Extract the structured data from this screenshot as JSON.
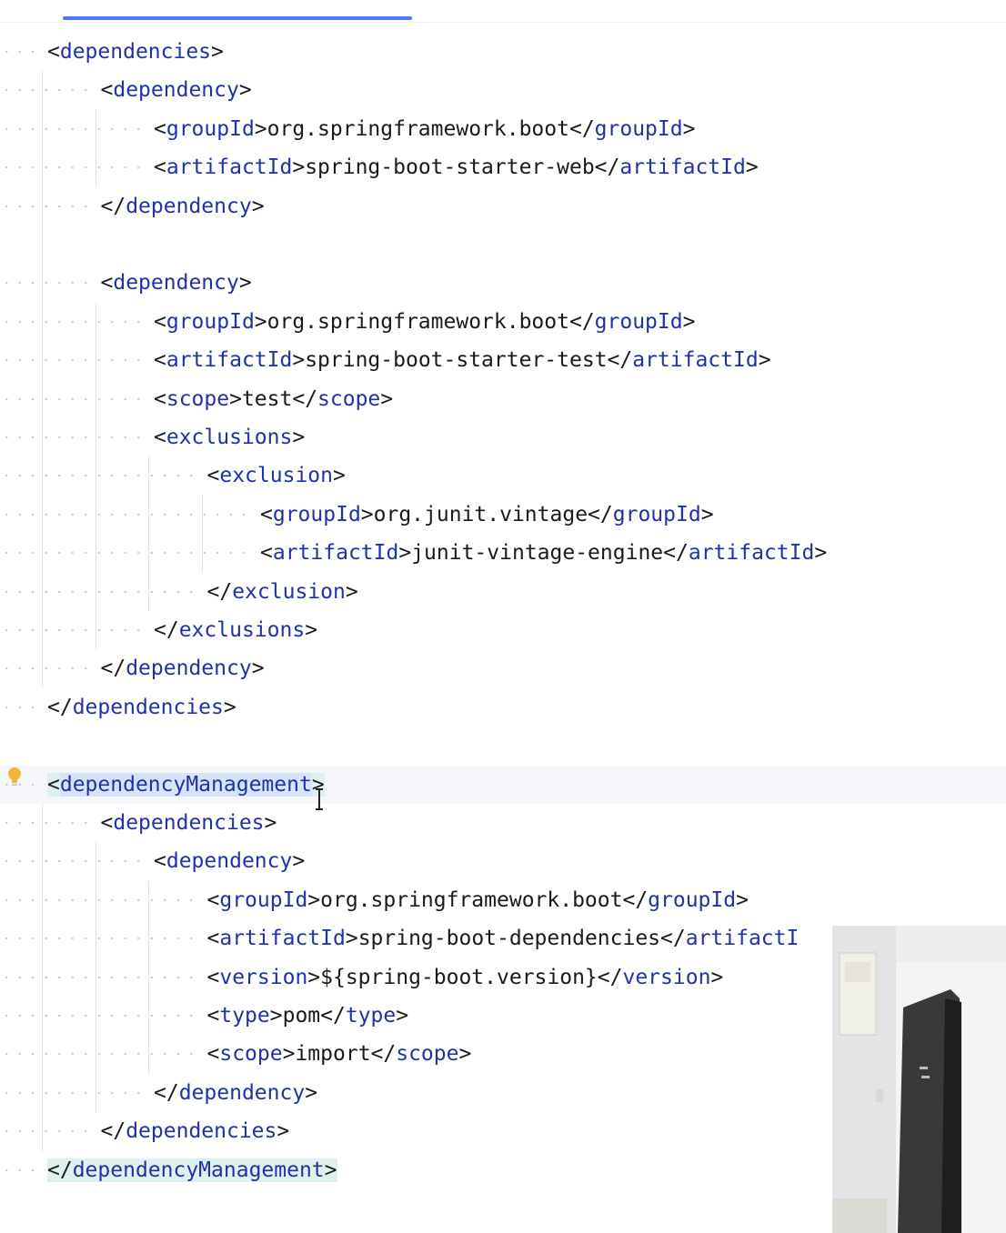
{
  "editor": {
    "lines": [
      {
        "indent": 0,
        "tokens": [
          {
            "t": "<",
            "k": "p"
          },
          {
            "t": "dependencies",
            "k": "tag"
          },
          {
            "t": ">",
            "k": "p"
          }
        ]
      },
      {
        "indent": 1,
        "tokens": [
          {
            "t": "<",
            "k": "p"
          },
          {
            "t": "dependency",
            "k": "tag"
          },
          {
            "t": ">",
            "k": "p"
          }
        ]
      },
      {
        "indent": 2,
        "tokens": [
          {
            "t": "<",
            "k": "p"
          },
          {
            "t": "groupId",
            "k": "tag"
          },
          {
            "t": ">org.springframework.boot</",
            "k": "p"
          },
          {
            "t": "groupId",
            "k": "tag"
          },
          {
            "t": ">",
            "k": "p"
          }
        ]
      },
      {
        "indent": 2,
        "tokens": [
          {
            "t": "<",
            "k": "p"
          },
          {
            "t": "artifactId",
            "k": "tag"
          },
          {
            "t": ">spring-boot-starter-web</",
            "k": "p"
          },
          {
            "t": "artifactId",
            "k": "tag"
          },
          {
            "t": ">",
            "k": "p"
          }
        ]
      },
      {
        "indent": 1,
        "tokens": [
          {
            "t": "</",
            "k": "p"
          },
          {
            "t": "dependency",
            "k": "tag"
          },
          {
            "t": ">",
            "k": "p"
          }
        ]
      },
      {
        "indent": 0,
        "tokens": []
      },
      {
        "indent": 1,
        "tokens": [
          {
            "t": "<",
            "k": "p"
          },
          {
            "t": "dependency",
            "k": "tag"
          },
          {
            "t": ">",
            "k": "p"
          }
        ]
      },
      {
        "indent": 2,
        "tokens": [
          {
            "t": "<",
            "k": "p"
          },
          {
            "t": "groupId",
            "k": "tag"
          },
          {
            "t": ">org.springframework.boot</",
            "k": "p"
          },
          {
            "t": "groupId",
            "k": "tag"
          },
          {
            "t": ">",
            "k": "p"
          }
        ]
      },
      {
        "indent": 2,
        "tokens": [
          {
            "t": "<",
            "k": "p"
          },
          {
            "t": "artifactId",
            "k": "tag"
          },
          {
            "t": ">spring-boot-starter-test</",
            "k": "p"
          },
          {
            "t": "artifactId",
            "k": "tag"
          },
          {
            "t": ">",
            "k": "p"
          }
        ]
      },
      {
        "indent": 2,
        "tokens": [
          {
            "t": "<",
            "k": "p"
          },
          {
            "t": "scope",
            "k": "tag"
          },
          {
            "t": ">test</",
            "k": "p"
          },
          {
            "t": "scope",
            "k": "tag"
          },
          {
            "t": ">",
            "k": "p"
          }
        ]
      },
      {
        "indent": 2,
        "tokens": [
          {
            "t": "<",
            "k": "p"
          },
          {
            "t": "exclusions",
            "k": "tag"
          },
          {
            "t": ">",
            "k": "p"
          }
        ]
      },
      {
        "indent": 3,
        "tokens": [
          {
            "t": "<",
            "k": "p"
          },
          {
            "t": "exclusion",
            "k": "tag"
          },
          {
            "t": ">",
            "k": "p"
          }
        ]
      },
      {
        "indent": 4,
        "tokens": [
          {
            "t": "<",
            "k": "p"
          },
          {
            "t": "groupId",
            "k": "tag"
          },
          {
            "t": ">org.junit.vintage</",
            "k": "p"
          },
          {
            "t": "groupId",
            "k": "tag"
          },
          {
            "t": ">",
            "k": "p"
          }
        ]
      },
      {
        "indent": 4,
        "tokens": [
          {
            "t": "<",
            "k": "p"
          },
          {
            "t": "artifactId",
            "k": "tag"
          },
          {
            "t": ">junit-vintage-engine</",
            "k": "p"
          },
          {
            "t": "artifactId",
            "k": "tag"
          },
          {
            "t": ">",
            "k": "p"
          }
        ]
      },
      {
        "indent": 3,
        "tokens": [
          {
            "t": "</",
            "k": "p"
          },
          {
            "t": "exclusion",
            "k": "tag"
          },
          {
            "t": ">",
            "k": "p"
          }
        ]
      },
      {
        "indent": 2,
        "tokens": [
          {
            "t": "</",
            "k": "p"
          },
          {
            "t": "exclusions",
            "k": "tag"
          },
          {
            "t": ">",
            "k": "p"
          }
        ]
      },
      {
        "indent": 1,
        "tokens": [
          {
            "t": "</",
            "k": "p"
          },
          {
            "t": "dependency",
            "k": "tag"
          },
          {
            "t": ">",
            "k": "p"
          }
        ]
      },
      {
        "indent": 0,
        "tokens": [
          {
            "t": "</",
            "k": "p"
          },
          {
            "t": "dependencies",
            "k": "tag"
          },
          {
            "t": ">",
            "k": "p"
          }
        ]
      },
      {
        "indent": 0,
        "tokens": []
      },
      {
        "indent": 0,
        "caret": true,
        "tokens": [
          {
            "t": "<",
            "k": "p",
            "pair": true
          },
          {
            "t": "dependencyManagement",
            "k": "tag",
            "hl": true
          },
          {
            "t": ">",
            "k": "p",
            "pair": true
          }
        ]
      },
      {
        "indent": 1,
        "tokens": [
          {
            "t": "<",
            "k": "p"
          },
          {
            "t": "dependencies",
            "k": "tag"
          },
          {
            "t": ">",
            "k": "p"
          }
        ]
      },
      {
        "indent": 2,
        "tokens": [
          {
            "t": "<",
            "k": "p"
          },
          {
            "t": "dependency",
            "k": "tag"
          },
          {
            "t": ">",
            "k": "p"
          }
        ]
      },
      {
        "indent": 3,
        "tokens": [
          {
            "t": "<",
            "k": "p"
          },
          {
            "t": "groupId",
            "k": "tag"
          },
          {
            "t": ">org.springframework.boot</",
            "k": "p"
          },
          {
            "t": "groupId",
            "k": "tag"
          },
          {
            "t": ">",
            "k": "p"
          }
        ]
      },
      {
        "indent": 3,
        "tokens": [
          {
            "t": "<",
            "k": "p"
          },
          {
            "t": "artifactId",
            "k": "tag"
          },
          {
            "t": ">spring-boot-dependencies</",
            "k": "p"
          },
          {
            "t": "artifactI",
            "k": "tag"
          }
        ]
      },
      {
        "indent": 3,
        "tokens": [
          {
            "t": "<",
            "k": "p"
          },
          {
            "t": "version",
            "k": "tag"
          },
          {
            "t": ">${spring-boot.version}</",
            "k": "p"
          },
          {
            "t": "version",
            "k": "tag"
          },
          {
            "t": ">",
            "k": "p"
          }
        ]
      },
      {
        "indent": 3,
        "tokens": [
          {
            "t": "<",
            "k": "p"
          },
          {
            "t": "type",
            "k": "tag"
          },
          {
            "t": ">pom</",
            "k": "p"
          },
          {
            "t": "type",
            "k": "tag"
          },
          {
            "t": ">",
            "k": "p"
          }
        ]
      },
      {
        "indent": 3,
        "tokens": [
          {
            "t": "<",
            "k": "p"
          },
          {
            "t": "scope",
            "k": "tag"
          },
          {
            "t": ">import</",
            "k": "p"
          },
          {
            "t": "scope",
            "k": "tag"
          },
          {
            "t": ">",
            "k": "p"
          }
        ]
      },
      {
        "indent": 2,
        "tokens": [
          {
            "t": "</",
            "k": "p"
          },
          {
            "t": "dependency",
            "k": "tag"
          },
          {
            "t": ">",
            "k": "p"
          }
        ]
      },
      {
        "indent": 1,
        "tokens": [
          {
            "t": "</",
            "k": "p"
          },
          {
            "t": "dependencies",
            "k": "tag"
          },
          {
            "t": ">",
            "k": "p"
          }
        ]
      },
      {
        "indent": 0,
        "tokens": [
          {
            "t": "</",
            "k": "p",
            "pair": true
          },
          {
            "t": "dependencyManagement",
            "k": "tag",
            "pair": true
          },
          {
            "t": ">",
            "k": "p",
            "pair": true
          }
        ]
      }
    ]
  },
  "icons": {
    "gutter": "lightbulb-icon",
    "pointer": "text-cursor-icon"
  },
  "colors": {
    "tag": "#1f33a8",
    "text": "#1a1a1a",
    "selection": "#d6e3fb",
    "matched_pair": "#def1ee",
    "tab_underline": "#4a7af5",
    "bulb": "#f2b63a"
  }
}
